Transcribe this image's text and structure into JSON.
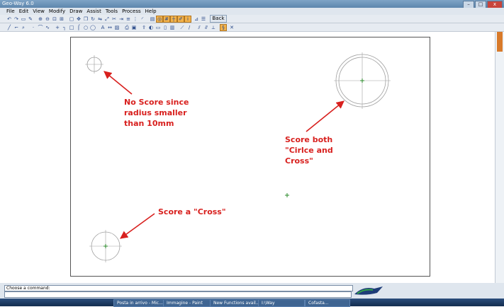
{
  "window": {
    "title": "Geo-Way 6.0",
    "minimize": "–",
    "maximize": "□",
    "close": "x"
  },
  "menu": [
    "File",
    "Edit",
    "View",
    "Modify",
    "Draw",
    "Assist",
    "Tools",
    "Process",
    "Help"
  ],
  "toolbar": {
    "back_label": "Back"
  },
  "annotations": {
    "no_score": [
      "No Score since",
      "radius smaller",
      "than 10mm"
    ],
    "score_both": [
      "Score both",
      "\"Cirlce and",
      "Cross\""
    ],
    "score_cross": "Score a \"Cross\""
  },
  "command": {
    "prompt": "Choose a command:"
  },
  "taskbar": {
    "items": [
      "Posta in arrivo - Mic...",
      "Immagine - Paint",
      "New Functions avail...",
      "I:\\Way",
      "Cofasta..."
    ]
  },
  "colors": {
    "annotation": "#d8201e",
    "accent_toolbar": "#f3b24a",
    "cross_marker": "#2a8a2a"
  }
}
